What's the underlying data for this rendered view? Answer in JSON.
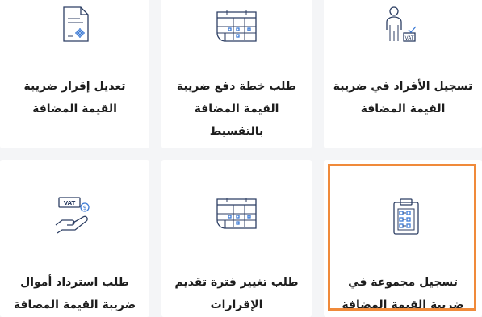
{
  "services": [
    {
      "id": "amend-return",
      "label": "تعديل إقرار ضريبة القيمة المضافة",
      "icon": "document-settings-icon"
    },
    {
      "id": "installment-plan",
      "label": "طلب خطة دفع ضريبة القيمة المضافة بالتقسيط",
      "icon": "calendar-icon"
    },
    {
      "id": "individual-registration",
      "label": "تسجيل الأفراد في ضريبة القيمة المضافة",
      "icon": "person-vat-icon"
    },
    {
      "id": "vat-refund",
      "label": "طلب استرداد أموال ضريبة القيمة المضافة",
      "icon": "vat-hand-icon"
    },
    {
      "id": "filing-period-change",
      "label": "طلب تغيير فترة تقديم الإقرارات",
      "icon": "calendar-icon"
    },
    {
      "id": "group-registration",
      "label": "تسجيل مجموعة في ضريبة القيمة المضافة",
      "icon": "clipboard-checklist-icon"
    }
  ],
  "vat_badge": "VAT",
  "colors": {
    "highlight": "#f08a3a",
    "icon_stroke": "#2c3e63",
    "icon_accent": "#3d7bd6"
  }
}
